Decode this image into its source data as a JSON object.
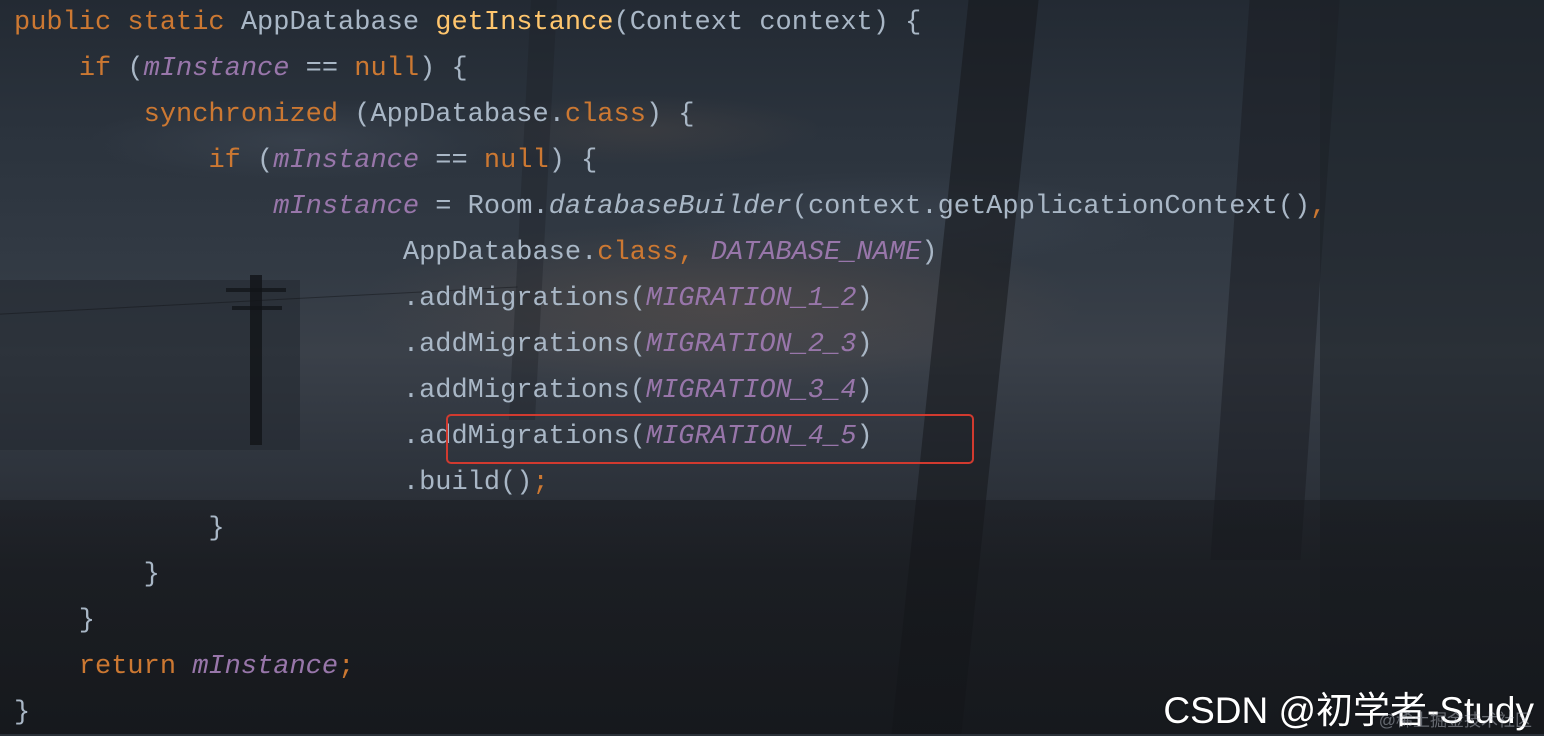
{
  "code_lines": [
    [
      {
        "text": "public static ",
        "kind": "keyword"
      },
      {
        "text": "AppDatabase ",
        "kind": "plain"
      },
      {
        "text": "getInstance",
        "kind": "method"
      },
      {
        "text": "(Context context) {",
        "kind": "plain"
      }
    ],
    [
      {
        "text": "    ",
        "kind": "plain"
      },
      {
        "text": "if ",
        "kind": "keyword"
      },
      {
        "text": "(",
        "kind": "plain"
      },
      {
        "text": "mInstance",
        "kind": "field"
      },
      {
        "text": " == ",
        "kind": "plain"
      },
      {
        "text": "null",
        "kind": "keyword"
      },
      {
        "text": ") {",
        "kind": "plain"
      }
    ],
    [
      {
        "text": "        ",
        "kind": "plain"
      },
      {
        "text": "synchronized ",
        "kind": "keyword"
      },
      {
        "text": "(AppDatabase.",
        "kind": "plain"
      },
      {
        "text": "class",
        "kind": "keyword"
      },
      {
        "text": ") {",
        "kind": "plain"
      }
    ],
    [
      {
        "text": "            ",
        "kind": "plain"
      },
      {
        "text": "if ",
        "kind": "keyword"
      },
      {
        "text": "(",
        "kind": "plain"
      },
      {
        "text": "mInstance",
        "kind": "field"
      },
      {
        "text": " == ",
        "kind": "plain"
      },
      {
        "text": "null",
        "kind": "keyword"
      },
      {
        "text": ") {",
        "kind": "plain"
      }
    ],
    [
      {
        "text": "                ",
        "kind": "plain"
      },
      {
        "text": "mInstance",
        "kind": "field"
      },
      {
        "text": " = Room.",
        "kind": "plain"
      },
      {
        "text": "databaseBuilder",
        "kind": "italic"
      },
      {
        "text": "(context.getApplicationContext()",
        "kind": "plain"
      },
      {
        "text": ",",
        "kind": "keyword"
      }
    ],
    [
      {
        "text": "                        AppDatabase.",
        "kind": "plain"
      },
      {
        "text": "class, ",
        "kind": "keyword"
      },
      {
        "text": "DATABASE_NAME",
        "kind": "field"
      },
      {
        "text": ")",
        "kind": "plain"
      }
    ],
    [
      {
        "text": "                        .addMigrations(",
        "kind": "plain"
      },
      {
        "text": "MIGRATION_1_2",
        "kind": "field"
      },
      {
        "text": ")",
        "kind": "plain"
      }
    ],
    [
      {
        "text": "                        .addMigrations(",
        "kind": "plain"
      },
      {
        "text": "MIGRATION_2_3",
        "kind": "field"
      },
      {
        "text": ")",
        "kind": "plain"
      }
    ],
    [
      {
        "text": "                        .addMigrations(",
        "kind": "plain"
      },
      {
        "text": "MIGRATION_3_4",
        "kind": "field"
      },
      {
        "text": ")",
        "kind": "plain"
      }
    ],
    [
      {
        "text": "                        .addMigrations(",
        "kind": "plain"
      },
      {
        "text": "MIGRATION_4_5",
        "kind": "field"
      },
      {
        "text": ")",
        "kind": "plain"
      }
    ],
    [
      {
        "text": "                        .build()",
        "kind": "plain"
      },
      {
        "text": ";",
        "kind": "keyword"
      }
    ],
    [
      {
        "text": "            }",
        "kind": "plain"
      }
    ],
    [
      {
        "text": "        }",
        "kind": "plain"
      }
    ],
    [
      {
        "text": "    }",
        "kind": "plain"
      }
    ],
    [
      {
        "text": "    ",
        "kind": "plain"
      },
      {
        "text": "return ",
        "kind": "keyword"
      },
      {
        "text": "mInstance",
        "kind": "field"
      },
      {
        "text": ";",
        "kind": "keyword"
      }
    ],
    [
      {
        "text": "}",
        "kind": "plain"
      }
    ]
  ],
  "highlight": {
    "line_number": 10,
    "color": "#d13a2f"
  },
  "colors": {
    "plain": "#a9b7c6",
    "keyword": "#cc7832",
    "method": "#ffc66d",
    "field": "#9876aa"
  },
  "watermark": {
    "text": "CSDN @初学者-Study",
    "faint_text": "@稀土掘金技术社区"
  }
}
